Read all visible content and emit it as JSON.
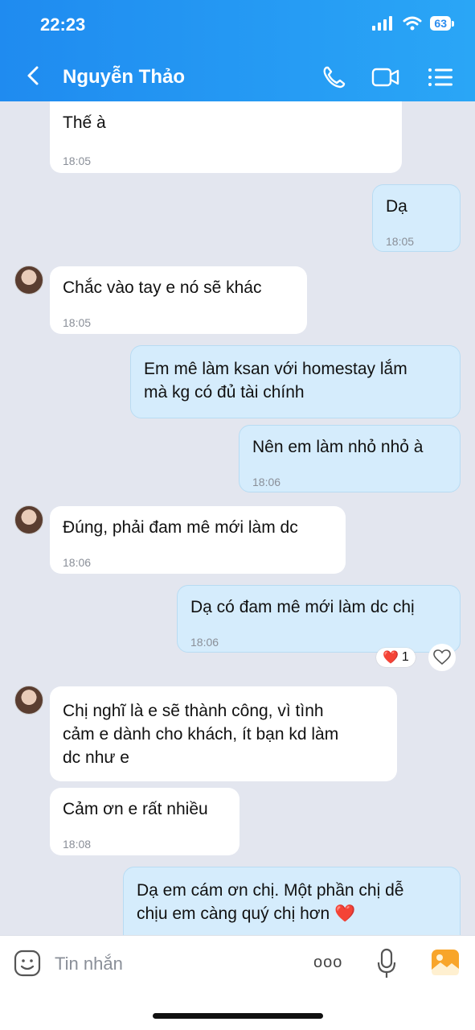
{
  "status_bar": {
    "time": "22:23",
    "battery": "63"
  },
  "header": {
    "title": "Nguyễn Thảo"
  },
  "messages": [
    {
      "text": "Thế à",
      "time": "18:05"
    },
    {
      "text": "Dạ",
      "time": "18:05"
    },
    {
      "text": "Chắc vào tay e nó sẽ khác",
      "time": "18:05"
    },
    {
      "text": "Em mê làm ksan với homestay lắm\nmà kg có đủ tài chính"
    },
    {
      "text": "Nên em làm nhỏ nhỏ à",
      "time": "18:06"
    },
    {
      "text": "Đúng, phải đam mê mới làm dc",
      "time": "18:06"
    },
    {
      "text": "Dạ có đam mê mới làm dc chị",
      "time": "18:06",
      "reaction": {
        "emoji": "❤️",
        "count": "1"
      }
    },
    {
      "text": "Chị nghĩ là e sẽ thành công, vì tình\ncảm e dành cho khách, ít bạn kd làm\ndc như e"
    },
    {
      "text": "Cảm ơn e rất nhiều",
      "time": "18:08"
    },
    {
      "text": "Dạ em cám ơn chị. Một phần chị dễ\nchịu em càng quý chị hơn ❤️"
    }
  ],
  "input": {
    "placeholder": "Tin nhắn",
    "more_label": "ooo"
  }
}
